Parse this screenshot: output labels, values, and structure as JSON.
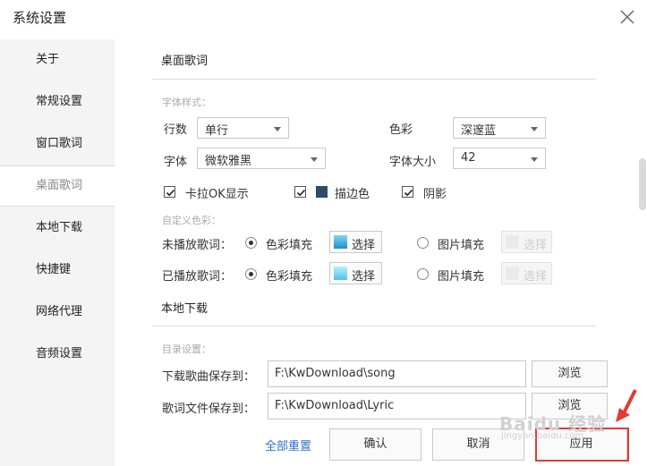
{
  "window": {
    "title": "系统设置",
    "close_icon": "close-icon"
  },
  "sidebar": {
    "items": [
      {
        "label": "关于",
        "active": false
      },
      {
        "label": "常规设置",
        "active": false
      },
      {
        "label": "窗口歌词",
        "active": false
      },
      {
        "label": "桌面歌词",
        "active": true
      },
      {
        "label": "本地下载",
        "active": false
      },
      {
        "label": "快捷键",
        "active": false
      },
      {
        "label": "网络代理",
        "active": false
      },
      {
        "label": "音频设置",
        "active": false
      }
    ]
  },
  "desktop_lyrics": {
    "title": "桌面歌词",
    "font_style_label": "字体样式：",
    "rows_label": "行数",
    "rows_value": "单行",
    "color_label": "色彩",
    "color_value": "深邃蓝",
    "font_label": "字体",
    "font_value": "微软雅黑",
    "font_size_label": "字体大小",
    "font_size_value": "42",
    "karaoke_label": "卡拉OK显示",
    "karaoke_checked": true,
    "stroke_label": "描边色",
    "stroke_checked": true,
    "stroke_color": "#2e4a66",
    "shadow_label": "阴影",
    "shadow_checked": true,
    "custom_color_label": "自定义色彩：",
    "unplayed_label": "未播放歌词：",
    "played_label": "已播放歌词：",
    "color_fill_label": "色彩填充",
    "select_label": "选择",
    "image_fill_label": "图片填充",
    "unplayed_swatch_color": "#2aa3d8",
    "played_swatch_color": "#6fd3f0"
  },
  "local_download": {
    "title": "本地下载",
    "dir_label": "目录设置：",
    "song_label": "下载歌曲保存到：",
    "song_path": "F:\\KwDownload\\song",
    "lyric_label": "歌词文件保存到：",
    "lyric_path": "F:\\KwDownload\\Lyric",
    "browse_label": "浏览"
  },
  "footer": {
    "reset_label": "全部重置",
    "ok_label": "确认",
    "cancel_label": "取消",
    "apply_label": "应用"
  },
  "watermark": {
    "text": "Baidu 经验",
    "sub": "jingyan.baidu.com"
  },
  "colors": {
    "accent_link": "#2f6fc4",
    "highlight_red": "#e53935"
  }
}
